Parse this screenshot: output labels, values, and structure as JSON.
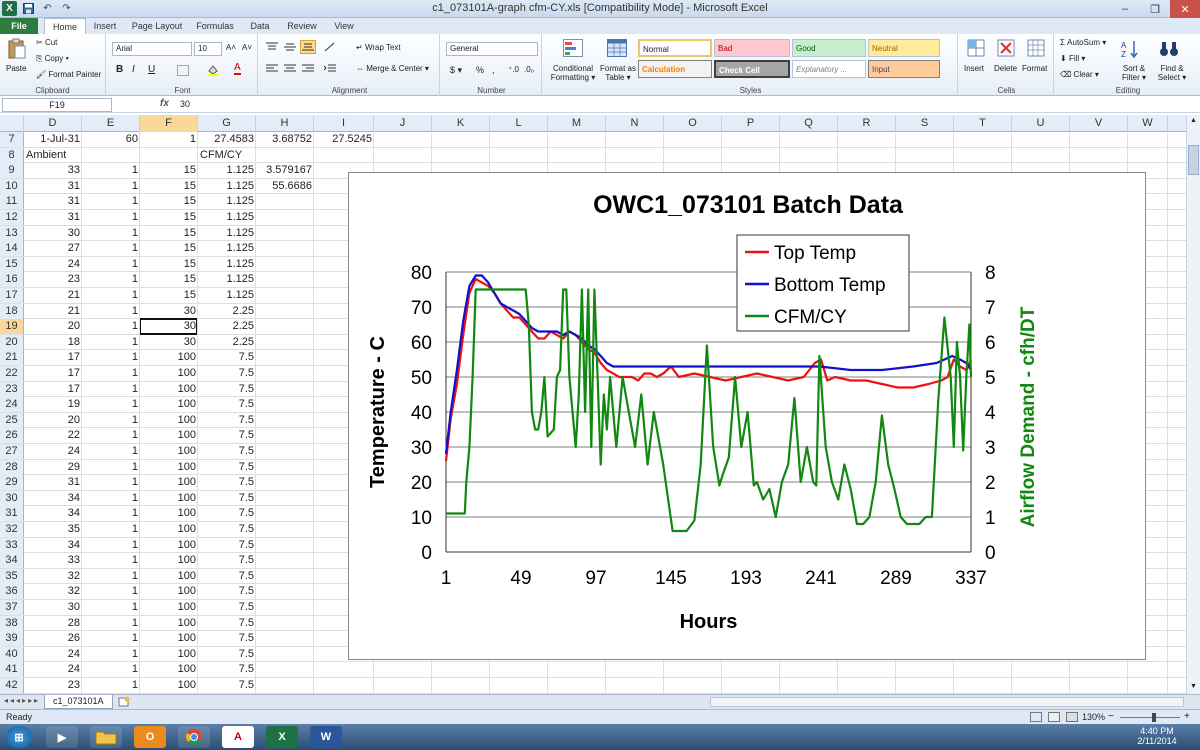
{
  "window": {
    "title": "c1_073101A-graph cfm-CY.xls  [Compatibility Mode]  -  Microsoft Excel",
    "minimize": "–",
    "restore": "❐",
    "close": "✕"
  },
  "qat": {
    "undo": "↶",
    "redo": "↷"
  },
  "tabs": [
    "File",
    "Home",
    "Insert",
    "Page Layout",
    "Formulas",
    "Data",
    "Review",
    "View"
  ],
  "ribbon": {
    "clipboard": {
      "paste": "Paste",
      "cut": "Cut",
      "copy": "Copy ▾",
      "format_painter": "Format Painter",
      "label": "Clipboard"
    },
    "font": {
      "name": "Arial",
      "size": "10",
      "bold": "B",
      "italic": "I",
      "underline": "U",
      "grow": "A˄",
      "shrink": "A˅",
      "color_letter": "A",
      "label": "Font"
    },
    "alignment": {
      "wrap": "Wrap Text",
      "merge": "Merge & Center ▾",
      "label": "Alignment"
    },
    "number": {
      "format": "General",
      "currency": "$ ▾",
      "percent": "%",
      "comma": ",",
      "inc": "⁺.0",
      "dec": ".0₀",
      "label": "Number"
    },
    "styles": {
      "conditional": "Conditional Formatting ▾",
      "as_table": "Format as Table ▾",
      "cells": [
        "Normal",
        "Bad",
        "Good",
        "Neutral",
        "Calculation",
        "Check Cell",
        "Explanatory ...",
        "Input"
      ],
      "label": "Styles"
    },
    "cells": {
      "insert": "Insert",
      "delete": "Delete",
      "format": "Format",
      "label": "Cells"
    },
    "editing": {
      "autosum": "AutoSum ▾",
      "fill": "Fill ▾",
      "clear": "Clear ▾",
      "sort": "Sort & Filter ▾",
      "find": "Find & Select ▾",
      "label": "Editing"
    }
  },
  "formula_bar": {
    "name_box": "F19",
    "fx": "fx",
    "value": "30"
  },
  "columns": [
    "D",
    "E",
    "F",
    "G",
    "H",
    "I",
    "J",
    "K",
    "L",
    "M",
    "N",
    "O",
    "P",
    "Q",
    "R",
    "S",
    "T",
    "U",
    "V",
    "W"
  ],
  "rows": [
    {
      "n": "7",
      "D": "1-Jul-31",
      "E": "60",
      "F": "1",
      "G": "27.4583",
      "H": "3.68752",
      "I": "27.5245"
    },
    {
      "n": "8",
      "D": "Ambient",
      "E": "",
      "F": "",
      "G": "CFM/CY",
      "H": "",
      "I": ""
    },
    {
      "n": "9",
      "D": "33",
      "E": "1",
      "F": "15",
      "G": "1.125",
      "H": "3.579167",
      "I": ""
    },
    {
      "n": "10",
      "D": "31",
      "E": "1",
      "F": "15",
      "G": "1.125",
      "H": "55.6686",
      "I": ""
    },
    {
      "n": "11",
      "D": "31",
      "E": "1",
      "F": "15",
      "G": "1.125",
      "H": "",
      "I": ""
    },
    {
      "n": "12",
      "D": "31",
      "E": "1",
      "F": "15",
      "G": "1.125",
      "H": "",
      "I": ""
    },
    {
      "n": "13",
      "D": "30",
      "E": "1",
      "F": "15",
      "G": "1.125",
      "H": "",
      "I": ""
    },
    {
      "n": "14",
      "D": "27",
      "E": "1",
      "F": "15",
      "G": "1.125",
      "H": "",
      "I": ""
    },
    {
      "n": "15",
      "D": "24",
      "E": "1",
      "F": "15",
      "G": "1.125",
      "H": "",
      "I": ""
    },
    {
      "n": "16",
      "D": "23",
      "E": "1",
      "F": "15",
      "G": "1.125",
      "H": "",
      "I": ""
    },
    {
      "n": "17",
      "D": "21",
      "E": "1",
      "F": "15",
      "G": "1.125",
      "H": "",
      "I": ""
    },
    {
      "n": "18",
      "D": "21",
      "E": "1",
      "F": "30",
      "G": "2.25",
      "H": "",
      "I": ""
    },
    {
      "n": "19",
      "D": "20",
      "E": "1",
      "F": "30",
      "G": "2.25",
      "H": "",
      "I": ""
    },
    {
      "n": "20",
      "D": "18",
      "E": "1",
      "F": "30",
      "G": "2.25",
      "H": "",
      "I": ""
    },
    {
      "n": "21",
      "D": "17",
      "E": "1",
      "F": "100",
      "G": "7.5",
      "H": "",
      "I": ""
    },
    {
      "n": "22",
      "D": "17",
      "E": "1",
      "F": "100",
      "G": "7.5",
      "H": "",
      "I": ""
    },
    {
      "n": "23",
      "D": "17",
      "E": "1",
      "F": "100",
      "G": "7.5",
      "H": "",
      "I": ""
    },
    {
      "n": "24",
      "D": "19",
      "E": "1",
      "F": "100",
      "G": "7.5",
      "H": "",
      "I": ""
    },
    {
      "n": "25",
      "D": "20",
      "E": "1",
      "F": "100",
      "G": "7.5",
      "H": "",
      "I": ""
    },
    {
      "n": "26",
      "D": "22",
      "E": "1",
      "F": "100",
      "G": "7.5",
      "H": "",
      "I": ""
    },
    {
      "n": "27",
      "D": "24",
      "E": "1",
      "F": "100",
      "G": "7.5",
      "H": "",
      "I": ""
    },
    {
      "n": "28",
      "D": "29",
      "E": "1",
      "F": "100",
      "G": "7.5",
      "H": "",
      "I": ""
    },
    {
      "n": "29",
      "D": "31",
      "E": "1",
      "F": "100",
      "G": "7.5",
      "H": "",
      "I": ""
    },
    {
      "n": "30",
      "D": "34",
      "E": "1",
      "F": "100",
      "G": "7.5",
      "H": "",
      "I": ""
    },
    {
      "n": "31",
      "D": "34",
      "E": "1",
      "F": "100",
      "G": "7.5",
      "H": "",
      "I": ""
    },
    {
      "n": "32",
      "D": "35",
      "E": "1",
      "F": "100",
      "G": "7.5",
      "H": "",
      "I": ""
    },
    {
      "n": "33",
      "D": "34",
      "E": "1",
      "F": "100",
      "G": "7.5",
      "H": "",
      "I": ""
    },
    {
      "n": "34",
      "D": "33",
      "E": "1",
      "F": "100",
      "G": "7.5",
      "H": "",
      "I": ""
    },
    {
      "n": "35",
      "D": "32",
      "E": "1",
      "F": "100",
      "G": "7.5",
      "H": "",
      "I": ""
    },
    {
      "n": "36",
      "D": "32",
      "E": "1",
      "F": "100",
      "G": "7.5",
      "H": "",
      "I": ""
    },
    {
      "n": "37",
      "D": "30",
      "E": "1",
      "F": "100",
      "G": "7.5",
      "H": "",
      "I": ""
    },
    {
      "n": "38",
      "D": "28",
      "E": "1",
      "F": "100",
      "G": "7.5",
      "H": "",
      "I": ""
    },
    {
      "n": "39",
      "D": "26",
      "E": "1",
      "F": "100",
      "G": "7.5",
      "H": "",
      "I": ""
    },
    {
      "n": "40",
      "D": "24",
      "E": "1",
      "F": "100",
      "G": "7.5",
      "H": "",
      "I": ""
    },
    {
      "n": "41",
      "D": "24",
      "E": "1",
      "F": "100",
      "G": "7.5",
      "H": "",
      "I": ""
    },
    {
      "n": "42",
      "D": "23",
      "E": "1",
      "F": "100",
      "G": "7.5",
      "H": "",
      "I": ""
    }
  ],
  "sheet_tab": "c1_073101A",
  "status": {
    "ready": "Ready",
    "zoom": "130%",
    "zoom_minus": "−",
    "zoom_plus": "+"
  },
  "taskbar": {
    "time": "4:40 PM",
    "date": "2/11/2014"
  },
  "colors": {
    "top_temp": "#ee1111",
    "bottom_temp": "#1111cc",
    "cfm": "#118811",
    "selected_header": "#f9d99a",
    "file_tab": "#2a7d3f"
  },
  "chart_data": {
    "type": "line",
    "title": "OWC1_073101 Batch Data",
    "xlabel": "Hours",
    "ylabel": "Temperature - C",
    "y2label": "Airflow Demand - cfh/DT",
    "xlim": [
      1,
      337
    ],
    "ylim": [
      0,
      80
    ],
    "y2lim": [
      0,
      8
    ],
    "x_ticks": [
      "1",
      "49",
      "97",
      "145",
      "193",
      "241",
      "289",
      "337"
    ],
    "y_ticks": [
      "0",
      "10",
      "20",
      "30",
      "40",
      "50",
      "60",
      "70",
      "80"
    ],
    "y2_ticks": [
      "0",
      "1",
      "2",
      "3",
      "4",
      "5",
      "6",
      "7",
      "8"
    ],
    "grid": "horizontal",
    "legend": "top-right",
    "series": [
      {
        "name": "Top Temp",
        "axis": "left",
        "color": "#ee1111",
        "x": [
          1,
          4,
          8,
          12,
          16,
          20,
          24,
          28,
          32,
          36,
          40,
          44,
          48,
          52,
          56,
          60,
          64,
          68,
          72,
          76,
          80,
          84,
          88,
          92,
          96,
          100,
          104,
          108,
          112,
          116,
          120,
          124,
          128,
          132,
          136,
          140,
          145,
          150,
          160,
          170,
          180,
          190,
          200,
          210,
          220,
          230,
          237,
          241,
          245,
          250,
          260,
          270,
          280,
          290,
          300,
          310,
          318,
          322,
          326,
          330,
          334,
          337
        ],
        "y": [
          26,
          38,
          48,
          62,
          74,
          78,
          77,
          76,
          74,
          71,
          69,
          67,
          67,
          65,
          63,
          61,
          61,
          63,
          62,
          61,
          63,
          62,
          60,
          58,
          57,
          54,
          52,
          51,
          50,
          50,
          50,
          49,
          51,
          51,
          50,
          51,
          53,
          50,
          51,
          50,
          49,
          50,
          51,
          50,
          49,
          50,
          54,
          55,
          49,
          50,
          49,
          49,
          48,
          47,
          47,
          48,
          49,
          50,
          55,
          53,
          52,
          55
        ]
      },
      {
        "name": "Bottom Temp",
        "axis": "left",
        "color": "#1111cc",
        "x": [
          1,
          4,
          8,
          12,
          16,
          20,
          24,
          28,
          32,
          36,
          40,
          44,
          48,
          52,
          56,
          60,
          64,
          68,
          72,
          76,
          80,
          84,
          88,
          92,
          96,
          100,
          104,
          108,
          112,
          120,
          140,
          160,
          180,
          200,
          220,
          240,
          260,
          280,
          300,
          315,
          320,
          325,
          330,
          334,
          337
        ],
        "y": [
          28,
          40,
          52,
          66,
          76,
          79,
          79,
          77,
          74,
          71,
          70,
          69,
          68,
          66,
          64,
          63,
          63,
          63,
          63,
          62,
          63,
          62,
          61,
          59,
          58,
          56,
          54,
          53,
          53,
          53,
          53,
          53,
          53,
          53,
          53,
          53,
          52,
          52,
          53,
          54,
          55,
          56,
          55,
          54,
          52
        ]
      },
      {
        "name": "CFM/CY",
        "axis": "right",
        "color": "#118811",
        "x": [
          1,
          8,
          13,
          14,
          16,
          18,
          20,
          24,
          28,
          32,
          36,
          40,
          44,
          48,
          52,
          54,
          56,
          58,
          60,
          62,
          64,
          66,
          70,
          72,
          74,
          76,
          78,
          80,
          84,
          86,
          88,
          90,
          92,
          94,
          96,
          98,
          100,
          102,
          104,
          106,
          110,
          114,
          118,
          122,
          126,
          130,
          134,
          140,
          146,
          150,
          155,
          160,
          164,
          168,
          172,
          176,
          178,
          182,
          186,
          190,
          194,
          198,
          200,
          204,
          208,
          212,
          216,
          220,
          224,
          228,
          232,
          236,
          238,
          240,
          244,
          248,
          252,
          256,
          260,
          264,
          268,
          272,
          276,
          280,
          284,
          288,
          292,
          296,
          300,
          304,
          308,
          312,
          316,
          320,
          324,
          326,
          328,
          330,
          332,
          334,
          336,
          337
        ],
        "y": [
          1.1,
          1.1,
          1.1,
          2.0,
          3.0,
          5.0,
          7.5,
          7.5,
          7.5,
          7.5,
          7.5,
          7.5,
          7.5,
          7.5,
          7.5,
          6.5,
          4.0,
          3.5,
          3.5,
          4.0,
          5.0,
          3.3,
          3.5,
          5.0,
          5.2,
          7.5,
          7.5,
          5.0,
          3.0,
          4.5,
          7.5,
          4.0,
          7.5,
          3.0,
          7.5,
          5.0,
          2.5,
          4.5,
          3.5,
          5.0,
          3.0,
          5.0,
          4.0,
          3.0,
          4.5,
          2.5,
          4.0,
          2.5,
          0.6,
          0.6,
          0.6,
          0.9,
          2.5,
          5.9,
          3.0,
          1.9,
          2.2,
          2.7,
          5.0,
          3.0,
          4.0,
          1.9,
          2.0,
          1.5,
          1.8,
          1.0,
          2.0,
          2.5,
          4.4,
          2.0,
          3.0,
          2.0,
          1.9,
          5.6,
          3.0,
          2.0,
          1.5,
          2.5,
          1.8,
          0.8,
          0.8,
          1.0,
          2.0,
          3.9,
          2.5,
          1.8,
          1.0,
          0.8,
          0.8,
          0.8,
          1.0,
          1.0,
          4.3,
          6.7,
          5.0,
          3.0,
          6.0,
          5.0,
          2.9,
          5.0,
          6.5,
          5.0
        ]
      }
    ]
  }
}
